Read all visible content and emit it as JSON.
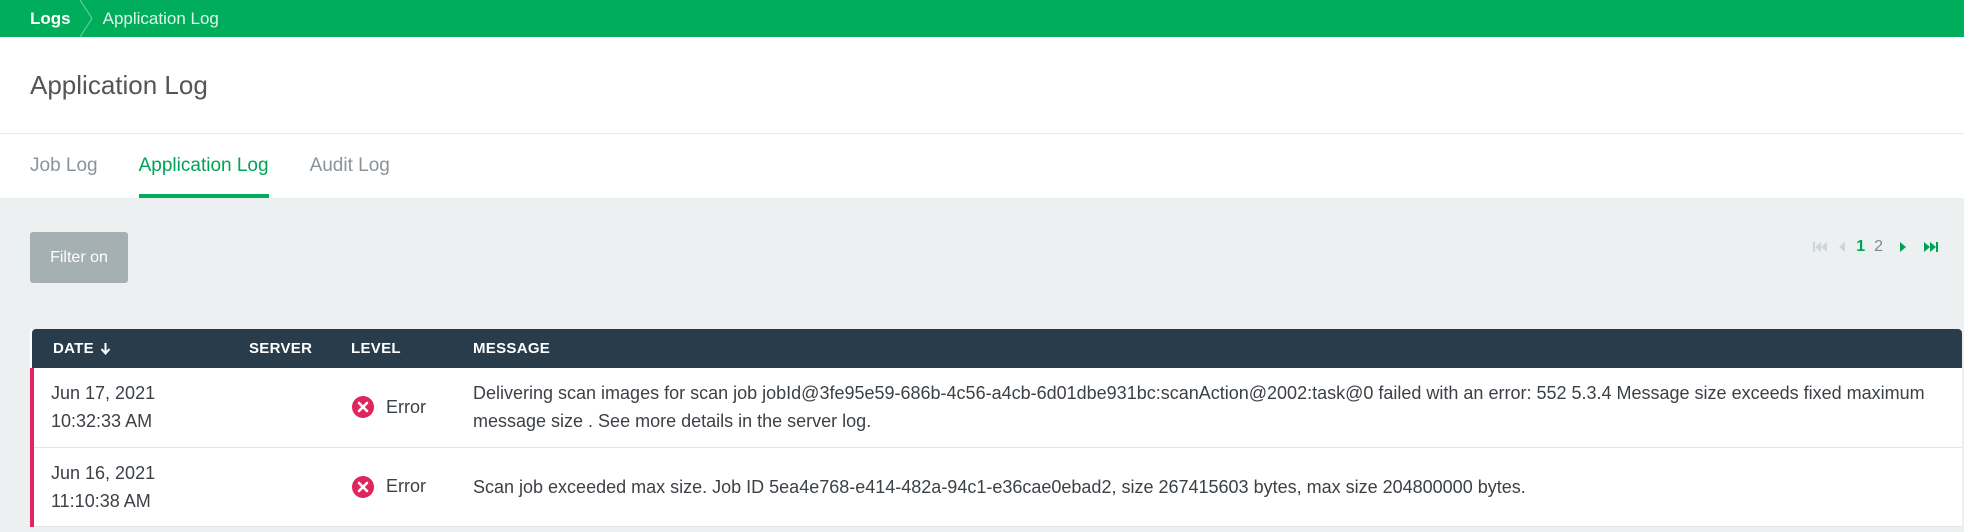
{
  "breadcrumb": {
    "items": [
      "Logs",
      "Application Log"
    ]
  },
  "page": {
    "title": "Application Log"
  },
  "tabs": [
    {
      "label": "Job Log",
      "active": false
    },
    {
      "label": "Application Log",
      "active": true
    },
    {
      "label": "Audit Log",
      "active": false
    }
  ],
  "toolbar": {
    "filter_label": "Filter on"
  },
  "pager": {
    "pages": [
      "1",
      "2"
    ],
    "current": "1"
  },
  "table": {
    "columns": [
      "DATE",
      "SERVER",
      "LEVEL",
      "MESSAGE"
    ],
    "rows": [
      {
        "date": "Jun 17, 2021",
        "time": "10:32:33 AM",
        "server": "",
        "level": "Error",
        "message": "Delivering scan images for scan job jobId@3fe95e59-686b-4c56-a4cb-6d01dbe931bc:scanAction@2002:task@0 failed with an error: 552 5.3.4 Message size exceeds fixed maximum message size . See more details in the server log."
      },
      {
        "date": "Jun 16, 2021",
        "time": "11:10:38 AM",
        "server": "",
        "level": "Error",
        "message": "Scan job exceeded max size. Job ID 5ea4e768-e414-482a-94c1-e36cae0ebad2, size 267415603 bytes, max size 204800000 bytes."
      }
    ]
  },
  "colors": {
    "brand": "#00ad5a",
    "header_bg": "#293c4b",
    "error": "#e0245e",
    "filter_button": "#a4b0b2"
  },
  "icons": {
    "sort": "arrow-down-icon",
    "error": "error-x-circle-icon",
    "pager_first": "first-page-icon",
    "pager_prev": "previous-page-icon",
    "pager_next": "next-page-icon",
    "pager_last": "last-page-icon"
  }
}
